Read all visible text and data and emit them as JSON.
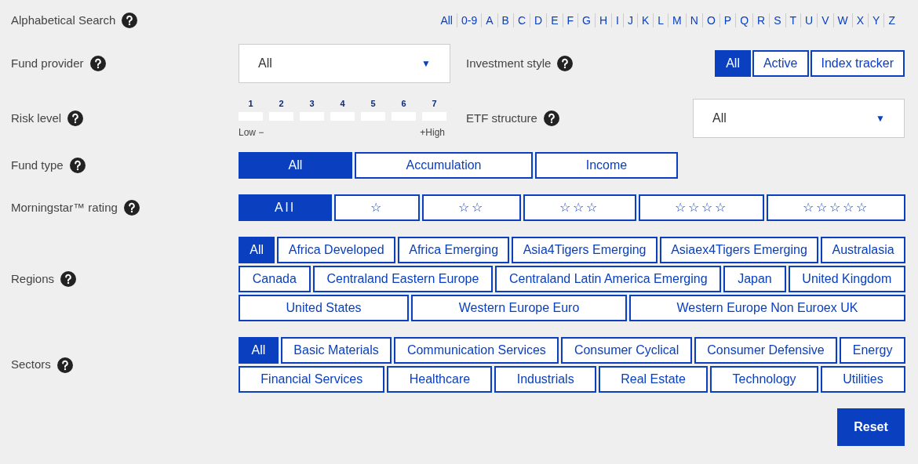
{
  "alphabetical_search": {
    "label": "Alphabetical Search",
    "letters": [
      {
        "label": "All",
        "selected": false
      },
      {
        "label": "0-9",
        "selected": false
      },
      {
        "label": "A",
        "selected": false
      },
      {
        "label": "B",
        "selected": false
      },
      {
        "label": "C",
        "selected": false
      },
      {
        "label": "D",
        "selected": false
      },
      {
        "label": "E",
        "selected": false
      },
      {
        "label": "F",
        "selected": false
      },
      {
        "label": "G",
        "selected": false
      },
      {
        "label": "H",
        "selected": false
      },
      {
        "label": "I",
        "selected": false
      },
      {
        "label": "J",
        "selected": false
      },
      {
        "label": "K",
        "selected": false
      },
      {
        "label": "L",
        "selected": false
      },
      {
        "label": "M",
        "selected": false
      },
      {
        "label": "N",
        "selected": false
      },
      {
        "label": "O",
        "selected": false
      },
      {
        "label": "P",
        "selected": false
      },
      {
        "label": "Q",
        "selected": false
      },
      {
        "label": "R",
        "selected": false
      },
      {
        "label": "S",
        "selected": false
      },
      {
        "label": "T",
        "selected": false
      },
      {
        "label": "U",
        "selected": false
      },
      {
        "label": "V",
        "selected": false
      },
      {
        "label": "W",
        "selected": false
      },
      {
        "label": "X",
        "selected": false
      },
      {
        "label": "Y",
        "selected": false
      },
      {
        "label": "Z",
        "selected": false
      }
    ]
  },
  "fund_provider": {
    "label": "Fund provider",
    "value": "All",
    "arrow": "▼"
  },
  "investment_style": {
    "label": "Investment style",
    "options": [
      {
        "label": "All",
        "selected": true
      },
      {
        "label": "Active",
        "selected": false
      },
      {
        "label": "Index tracker",
        "selected": false
      }
    ]
  },
  "risk_level": {
    "label": "Risk level",
    "levels": [
      {
        "label": "1",
        "selected": false
      },
      {
        "label": "2",
        "selected": false
      },
      {
        "label": "3",
        "selected": false
      },
      {
        "label": "4",
        "selected": false
      },
      {
        "label": "5",
        "selected": false
      },
      {
        "label": "6",
        "selected": false
      },
      {
        "label": "7",
        "selected": false
      }
    ],
    "low": "Low",
    "low_mark": "−",
    "high": "High",
    "high_mark": "+"
  },
  "etf_structure": {
    "label": "ETF structure",
    "value": "All",
    "arrow": "▼"
  },
  "fund_type": {
    "label": "Fund type",
    "options": [
      {
        "label": "All",
        "selected": true
      },
      {
        "label": "Accumulation",
        "selected": false
      },
      {
        "label": "Income",
        "selected": false
      }
    ]
  },
  "morningstar_rating": {
    "label": "Morningstar™ rating",
    "options": [
      {
        "label": "All",
        "selected": true
      },
      {
        "label": "☆",
        "selected": false
      },
      {
        "label": "☆☆",
        "selected": false
      },
      {
        "label": "☆☆☆",
        "selected": false
      },
      {
        "label": "☆☆☆☆",
        "selected": false
      },
      {
        "label": "☆☆☆☆☆",
        "selected": false
      }
    ]
  },
  "regions": {
    "label": "Regions",
    "rows": [
      {
        "options": [
          {
            "label": "All",
            "selected": true
          },
          {
            "label": "Africa Developed",
            "selected": false
          },
          {
            "label": "Africa Emerging",
            "selected": false
          },
          {
            "label": "Asia4Tigers Emerging",
            "selected": false
          },
          {
            "label": "Asiaex4Tigers Emerging",
            "selected": false
          },
          {
            "label": "Australasia",
            "selected": false
          }
        ]
      },
      {
        "options": [
          {
            "label": "Canada",
            "selected": false
          },
          {
            "label": "Centraland Eastern Europe",
            "selected": false
          },
          {
            "label": "Centraland Latin America Emerging",
            "selected": false
          },
          {
            "label": "Japan",
            "selected": false
          },
          {
            "label": "United Kingdom",
            "selected": false
          }
        ]
      },
      {
        "options": [
          {
            "label": "United States",
            "selected": false
          },
          {
            "label": "Western Europe Euro",
            "selected": false
          },
          {
            "label": "Western Europe Non Euroex UK",
            "selected": false
          }
        ]
      }
    ]
  },
  "sectors": {
    "label": "Sectors",
    "rows": [
      {
        "options": [
          {
            "label": "All",
            "selected": true
          },
          {
            "label": "Basic Materials",
            "selected": false
          },
          {
            "label": "Communication Services",
            "selected": false
          },
          {
            "label": "Consumer Cyclical",
            "selected": false
          },
          {
            "label": "Consumer Defensive",
            "selected": false
          },
          {
            "label": "Energy",
            "selected": false
          }
        ]
      },
      {
        "options": [
          {
            "label": "Financial Services",
            "selected": false
          },
          {
            "label": "Healthcare",
            "selected": false
          },
          {
            "label": "Industrials",
            "selected": false
          },
          {
            "label": "Real Estate",
            "selected": false
          },
          {
            "label": "Technology",
            "selected": false
          },
          {
            "label": "Utilities",
            "selected": false
          }
        ]
      }
    ]
  },
  "reset_button": "Reset"
}
